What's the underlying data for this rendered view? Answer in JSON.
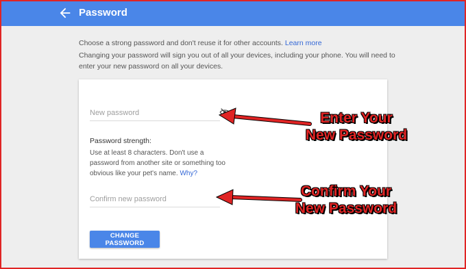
{
  "header": {
    "title": "Password",
    "back_icon": "arrow-left-icon",
    "color": "#4a86e8"
  },
  "intro": {
    "line1": "Choose a strong password and don't reuse it for other accounts.",
    "learn_more": "Learn more",
    "line2": "Changing your password will sign you out of all your devices, including your phone. You will need to enter your new password on all your devices."
  },
  "form": {
    "new_password_placeholder": "New password",
    "new_password_value": "",
    "visibility_icon": "eye-off-icon",
    "strength_label": "Password strength:",
    "strength_help": "Use at least 8 characters. Don't use a password from another site or something too obvious like your pet's name.",
    "why_link": "Why?",
    "confirm_password_placeholder": "Confirm new password",
    "confirm_password_value": "",
    "submit_label": "CHANGE PASSWORD"
  },
  "annotations": {
    "callout1_line1": "Enter Your",
    "callout1_line2": "New Password",
    "callout2_line1": "Confirm Your",
    "callout2_line2": "New Password",
    "color": "#e02424"
  }
}
